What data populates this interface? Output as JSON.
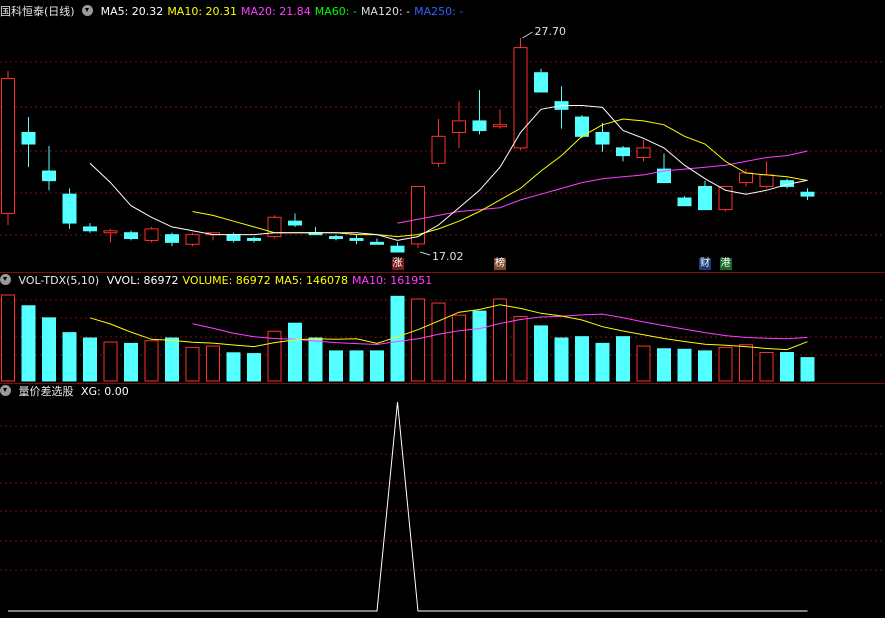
{
  "price_panel": {
    "title": "国科恒泰(日线)",
    "indicators": [
      {
        "label": "MA5:",
        "value": "20.32",
        "color": "#ffffff"
      },
      {
        "label": "MA10:",
        "value": "20.31",
        "color": "#ffff00"
      },
      {
        "label": "MA20:",
        "value": "21.84",
        "color": "#ff40ff"
      },
      {
        "label": "MA60:",
        "value": "-",
        "color": "#00ff00"
      },
      {
        "label": "MA120:",
        "value": "-",
        "color": "#dddddd"
      },
      {
        "label": "MA250:",
        "value": "-",
        "color": "#3060ff"
      }
    ],
    "high_label": "27.70",
    "low_label": "17.02",
    "markers": [
      {
        "text": "涨",
        "bg": "#7a1a1a"
      },
      {
        "text": "榜",
        "bg": "#7a4a2a"
      },
      {
        "text": "财",
        "bg": "#1a3a7a"
      },
      {
        "text": "港",
        "bg": "#1a6a2a"
      }
    ]
  },
  "volume_panel": {
    "title": "VOL-TDX(5,10)",
    "indicators": [
      {
        "label": "VVOL:",
        "value": "86972",
        "color": "#ffffff"
      },
      {
        "label": "VOLUME:",
        "value": "86972",
        "color": "#ffff00"
      },
      {
        "label": "MA5:",
        "value": "146078",
        "color": "#ffff00"
      },
      {
        "label": "MA10:",
        "value": "161951",
        "color": "#ff40ff"
      }
    ]
  },
  "signal_panel": {
    "title": "量价差选股",
    "indicators": [
      {
        "label": "XG:",
        "value": "0.00",
        "color": "#ffffff"
      }
    ]
  },
  "colors": {
    "up": "#ff3030",
    "down": "#54ffff",
    "grid": "#7a1010"
  },
  "chart_data": [
    {
      "type": "candlestick",
      "candles": [
        {
          "o": 18.6,
          "h": 26.0,
          "l": 18.0,
          "c": 25.6
        },
        {
          "o": 22.8,
          "h": 23.6,
          "l": 21.0,
          "c": 22.2
        },
        {
          "o": 20.8,
          "h": 22.1,
          "l": 19.8,
          "c": 20.3
        },
        {
          "o": 19.6,
          "h": 19.9,
          "l": 17.8,
          "c": 18.1
        },
        {
          "o": 17.9,
          "h": 18.1,
          "l": 17.6,
          "c": 17.7
        },
        {
          "o": 17.6,
          "h": 17.8,
          "l": 17.1,
          "c": 17.7
        },
        {
          "o": 17.6,
          "h": 17.7,
          "l": 17.2,
          "c": 17.3
        },
        {
          "o": 17.2,
          "h": 17.9,
          "l": 17.1,
          "c": 17.8
        },
        {
          "o": 17.5,
          "h": 17.6,
          "l": 16.9,
          "c": 17.1
        },
        {
          "o": 17.0,
          "h": 17.6,
          "l": 16.9,
          "c": 17.5
        },
        {
          "o": 17.5,
          "h": 17.6,
          "l": 17.2,
          "c": 17.6
        },
        {
          "o": 17.5,
          "h": 17.6,
          "l": 17.1,
          "c": 17.2
        },
        {
          "o": 17.3,
          "h": 17.4,
          "l": 17.1,
          "c": 17.2
        },
        {
          "o": 17.4,
          "h": 18.5,
          "l": 17.3,
          "c": 18.4
        },
        {
          "o": 18.2,
          "h": 18.6,
          "l": 17.9,
          "c": 18.0
        },
        {
          "o": 17.6,
          "h": 17.9,
          "l": 17.5,
          "c": 17.5
        },
        {
          "o": 17.4,
          "h": 17.5,
          "l": 17.2,
          "c": 17.3
        },
        {
          "o": 17.3,
          "h": 17.5,
          "l": 17.0,
          "c": 17.2
        },
        {
          "o": 17.1,
          "h": 17.3,
          "l": 17.0,
          "c": 17.0
        },
        {
          "o": 16.9,
          "h": 17.1,
          "l": 16.6,
          "c": 16.6
        },
        {
          "o": 17.02,
          "h": 20.0,
          "l": 16.8,
          "c": 20.0
        },
        {
          "o": 21.2,
          "h": 23.5,
          "l": 21.0,
          "c": 22.6
        },
        {
          "o": 22.8,
          "h": 24.4,
          "l": 22.0,
          "c": 23.4
        },
        {
          "o": 23.4,
          "h": 25.0,
          "l": 22.7,
          "c": 22.9
        },
        {
          "o": 23.1,
          "h": 24.0,
          "l": 23.0,
          "c": 23.2
        },
        {
          "o": 22.0,
          "h": 27.7,
          "l": 21.9,
          "c": 27.2
        },
        {
          "o": 25.9,
          "h": 26.1,
          "l": 24.9,
          "c": 24.9
        },
        {
          "o": 24.4,
          "h": 25.2,
          "l": 23.0,
          "c": 24.0
        },
        {
          "o": 23.6,
          "h": 23.7,
          "l": 22.5,
          "c": 22.6
        },
        {
          "o": 22.8,
          "h": 23.3,
          "l": 21.8,
          "c": 22.2
        },
        {
          "o": 22.0,
          "h": 22.1,
          "l": 21.3,
          "c": 21.6
        },
        {
          "o": 21.5,
          "h": 22.4,
          "l": 21.3,
          "c": 22.0
        },
        {
          "o": 20.9,
          "h": 21.7,
          "l": 20.2,
          "c": 20.2
        },
        {
          "o": 19.4,
          "h": 19.5,
          "l": 19.0,
          "c": 19.0
        },
        {
          "o": 20.0,
          "h": 20.3,
          "l": 18.8,
          "c": 18.8
        },
        {
          "o": 18.8,
          "h": 20.0,
          "l": 18.7,
          "c": 20.0
        },
        {
          "o": 20.2,
          "h": 20.9,
          "l": 20.0,
          "c": 20.7
        },
        {
          "o": 20.0,
          "h": 21.3,
          "l": 19.9,
          "c": 20.6
        },
        {
          "o": 20.3,
          "h": 20.4,
          "l": 19.9,
          "c": 20.0
        },
        {
          "o": 19.7,
          "h": 19.9,
          "l": 19.3,
          "c": 19.5
        }
      ],
      "ma5": [
        null,
        null,
        null,
        null,
        21.2,
        20.2,
        19.0,
        18.4,
        17.9,
        17.7,
        17.5,
        17.5,
        17.5,
        17.6,
        17.6,
        17.6,
        17.6,
        17.6,
        17.5,
        17.2,
        17.4,
        18.0,
        18.9,
        19.8,
        21.0,
        22.8,
        24.0,
        24.2,
        24.2,
        24.1,
        22.9,
        22.5,
        22.0,
        21.1,
        20.4,
        19.8,
        19.6,
        19.8,
        20.1,
        20.32
      ],
      "ma10": [
        null,
        null,
        null,
        null,
        null,
        null,
        null,
        null,
        null,
        18.7,
        18.5,
        18.2,
        17.9,
        17.6,
        17.6,
        17.6,
        17.6,
        17.5,
        17.5,
        17.4,
        17.5,
        17.8,
        18.2,
        18.7,
        19.3,
        19.9,
        20.8,
        21.6,
        22.6,
        23.2,
        23.5,
        23.4,
        23.2,
        22.6,
        22.2,
        21.3,
        20.7,
        20.6,
        20.5,
        20.31
      ],
      "ma20": [
        null,
        null,
        null,
        null,
        null,
        null,
        null,
        null,
        null,
        null,
        null,
        null,
        null,
        null,
        null,
        null,
        null,
        null,
        null,
        18.1,
        18.3,
        18.5,
        18.7,
        18.8,
        18.9,
        19.3,
        19.6,
        19.9,
        20.2,
        20.4,
        20.5,
        20.6,
        20.8,
        20.9,
        21.0,
        21.1,
        21.3,
        21.5,
        21.6,
        21.84
      ],
      "y_label_max": "27.70",
      "y_label_min": "17.02"
    },
    {
      "type": "bar",
      "series_name": "VOLUME",
      "values": [
        320000,
        280000,
        235000,
        180000,
        160000,
        145000,
        140000,
        150000,
        160000,
        125000,
        130000,
        105000,
        102000,
        185000,
        215000,
        160000,
        112000,
        112000,
        112000,
        315000,
        305000,
        290000,
        245000,
        260000,
        305000,
        240000,
        205000,
        160000,
        165000,
        140000,
        165000,
        130000,
        120000,
        118000,
        112000,
        125000,
        135000,
        106000,
        106000,
        86972
      ],
      "ma5": [
        null,
        null,
        null,
        null,
        235000,
        212000,
        182000,
        155000,
        151000,
        144000,
        141000,
        134000,
        128000,
        143000,
        153000,
        157000,
        155000,
        157000,
        140000,
        165000,
        191000,
        223000,
        256000,
        266000,
        284000,
        270000,
        252000,
        242000,
        227000,
        202000,
        186000,
        172000,
        158000,
        147000,
        137000,
        133000,
        128000,
        121000,
        117000,
        146078
      ],
      "ma10": [
        null,
        null,
        null,
        null,
        null,
        null,
        null,
        null,
        null,
        213000,
        196000,
        178000,
        165000,
        158000,
        155000,
        149000,
        143000,
        139000,
        136000,
        147000,
        157000,
        174000,
        187000,
        195000,
        214000,
        229000,
        238000,
        241000,
        246000,
        249000,
        235000,
        220000,
        206000,
        193000,
        180000,
        169000,
        162000,
        159000,
        157000,
        161951
      ]
    },
    {
      "type": "line",
      "series_name": "XG",
      "values": [
        0,
        0,
        0,
        0,
        0,
        0,
        0,
        0,
        0,
        0,
        0,
        0,
        0,
        0,
        0,
        0,
        0,
        0,
        0,
        1,
        0,
        0,
        0,
        0,
        0,
        0,
        0,
        0,
        0,
        0,
        0,
        0,
        0,
        0,
        0,
        0,
        0,
        0,
        0,
        0
      ],
      "ylim": [
        0,
        1
      ]
    }
  ]
}
